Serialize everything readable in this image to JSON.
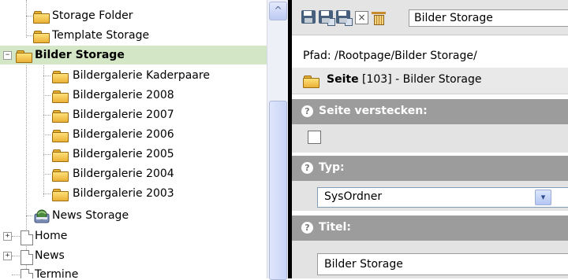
{
  "tree": {
    "items": [
      {
        "label": "Storage Folder",
        "icon": "folder-icon"
      },
      {
        "label": "Template Storage",
        "icon": "folder-icon"
      },
      {
        "label": "Bilder Storage",
        "icon": "folder-icon",
        "selected": true,
        "toggle": "−"
      },
      {
        "label": "Bildergalerie Kaderpaare",
        "icon": "folder-icon"
      },
      {
        "label": "Bildergalerie 2008",
        "icon": "folder-icon"
      },
      {
        "label": "Bildergalerie 2007",
        "icon": "folder-icon"
      },
      {
        "label": "Bildergalerie 2006",
        "icon": "folder-icon"
      },
      {
        "label": "Bildergalerie 2005",
        "icon": "folder-icon"
      },
      {
        "label": "Bildergalerie 2004",
        "icon": "folder-icon"
      },
      {
        "label": "Bildergalerie 2003",
        "icon": "folder-icon"
      },
      {
        "label": "News Storage",
        "icon": "news-storage-icon"
      },
      {
        "label": "Home",
        "icon": "page-icon",
        "toggle": "+"
      },
      {
        "label": "News",
        "icon": "page-icon",
        "toggle": "+"
      },
      {
        "label": "Termine",
        "icon": "page-icon"
      }
    ],
    "scroll_up_symbol": "^"
  },
  "toolbar": {
    "title_value": "Bilder Storage",
    "close_symbol": "×"
  },
  "path": {
    "text": "Pfad: /Rootpage/Bilder Storage/"
  },
  "page_header": {
    "type_label": "Seite",
    "rest": " [103] - Bilder Storage"
  },
  "sections": {
    "hide": {
      "label": "Seite verstecken:",
      "help": "?"
    },
    "type": {
      "label": "Typ:",
      "help": "?",
      "value": "SysOrdner",
      "arrow": "▾"
    },
    "title": {
      "label": "Titel:",
      "help": "?",
      "value": "Bilder Storage"
    }
  },
  "colors": {
    "selected_row": "#d3e7c6",
    "section_header": "#9c9c9c",
    "toolbar": "#e4e4e4"
  }
}
